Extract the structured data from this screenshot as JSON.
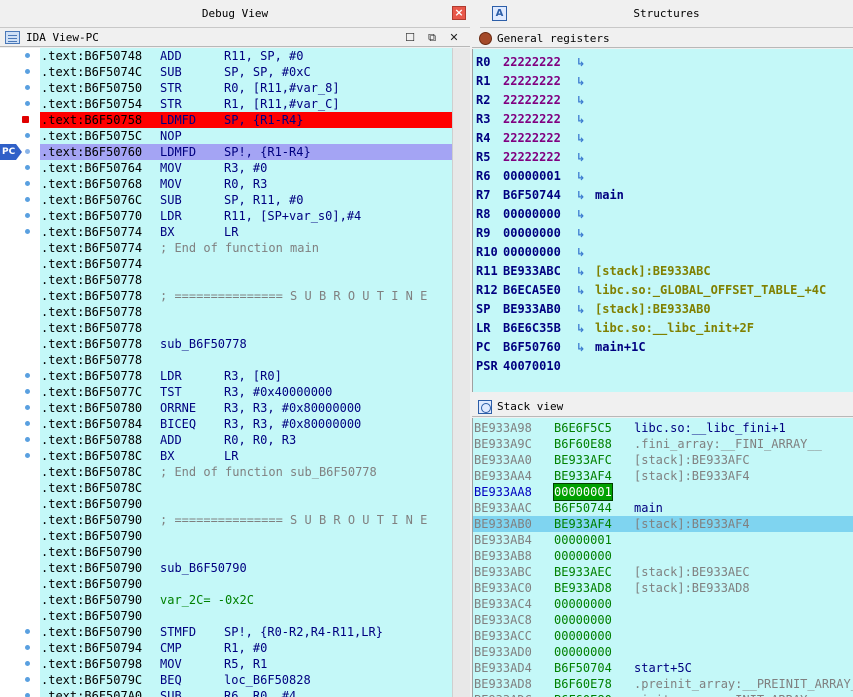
{
  "tabs": {
    "debug_view": "Debug View",
    "structures": "Structures",
    "close_glyph": "×"
  },
  "ida_view": {
    "title": "IDA View-PC",
    "pc_label": "PC",
    "lines": [
      {
        "addr": ".text:B6F50748",
        "mn": "ADD",
        "ops": "R11, SP, #0",
        "dot": true
      },
      {
        "addr": ".text:B6F5074C",
        "mn": "SUB",
        "ops": "SP, SP, #0xC",
        "dot": true
      },
      {
        "addr": ".text:B6F50750",
        "mn": "STR",
        "ops": "R0, [R11,#var_8]",
        "dot": true
      },
      {
        "addr": ".text:B6F50754",
        "mn": "STR",
        "ops": "R1, [R11,#var_C]",
        "dot": true
      },
      {
        "addr": ".text:B6F50758",
        "mn": "LDMFD",
        "ops": "SP, {R1-R4}",
        "dot": false,
        "bp": true,
        "hl": "red"
      },
      {
        "addr": ".text:B6F5075C",
        "mn": "NOP",
        "ops": "",
        "dot": true
      },
      {
        "addr": ".text:B6F50760",
        "mn": "LDMFD",
        "ops": "SP!, {R1-R4}",
        "dot": false,
        "pc": true,
        "hl": "pc"
      },
      {
        "addr": ".text:B6F50764",
        "mn": "MOV",
        "ops": "R3, #0",
        "dot": true
      },
      {
        "addr": ".text:B6F50768",
        "mn": "MOV",
        "ops": "R0, R3",
        "dot": true
      },
      {
        "addr": ".text:B6F5076C",
        "mn": "SUB",
        "ops": "SP, R11, #0",
        "dot": true
      },
      {
        "addr": ".text:B6F50770",
        "mn": "LDR",
        "ops": "R11, [SP+var_s0],#4",
        "dot": true
      },
      {
        "addr": ".text:B6F50774",
        "mn": "BX",
        "ops": "LR",
        "dot": true
      },
      {
        "addr": ".text:B6F50774",
        "comment": "; End of function main"
      },
      {
        "addr": ".text:B6F50774"
      },
      {
        "addr": ".text:B6F50778"
      },
      {
        "addr": ".text:B6F50778",
        "comment": "; =============== S U B R O U T I N E"
      },
      {
        "addr": ".text:B6F50778"
      },
      {
        "addr": ".text:B6F50778"
      },
      {
        "addr": ".text:B6F50778",
        "label": "sub_B6F50778"
      },
      {
        "addr": ".text:B6F50778"
      },
      {
        "addr": ".text:B6F50778",
        "mn": "LDR",
        "ops": "R3, [R0]",
        "dot": true
      },
      {
        "addr": ".text:B6F5077C",
        "mn": "TST",
        "ops": "R3, #0x40000000",
        "dot": true
      },
      {
        "addr": ".text:B6F50780",
        "mn": "ORRNE",
        "ops": "R3, R3, #0x80000000",
        "dot": true
      },
      {
        "addr": ".text:B6F50784",
        "mn": "BICEQ",
        "ops": "R3, R3, #0x80000000",
        "dot": true
      },
      {
        "addr": ".text:B6F50788",
        "mn": "ADD",
        "ops": "R0, R0, R3",
        "dot": true
      },
      {
        "addr": ".text:B6F5078C",
        "mn": "BX",
        "ops": "LR",
        "dot": true
      },
      {
        "addr": ".text:B6F5078C",
        "comment": "; End of function sub_B6F50778"
      },
      {
        "addr": ".text:B6F5078C"
      },
      {
        "addr": ".text:B6F50790"
      },
      {
        "addr": ".text:B6F50790",
        "comment": "; =============== S U B R O U T I N E"
      },
      {
        "addr": ".text:B6F50790"
      },
      {
        "addr": ".text:B6F50790"
      },
      {
        "addr": ".text:B6F50790",
        "label": "sub_B6F50790"
      },
      {
        "addr": ".text:B6F50790"
      },
      {
        "addr": ".text:B6F50790",
        "varline": "var_2C= -0x2C"
      },
      {
        "addr": ".text:B6F50790"
      },
      {
        "addr": ".text:B6F50790",
        "mn": "STMFD",
        "ops": "SP!, {R0-R2,R4-R11,LR}",
        "dot": true
      },
      {
        "addr": ".text:B6F50794",
        "mn": "CMP",
        "ops": "R1, #0",
        "dot": true
      },
      {
        "addr": ".text:B6F50798",
        "mn": "MOV",
        "ops": "R5, R1",
        "dot": true
      },
      {
        "addr": ".text:B6F5079C",
        "mn": "BEQ",
        "ops": "loc_B6F50828",
        "dot": true
      },
      {
        "addr": ".text:B6F507A0",
        "mn": "SUB",
        "ops": "R6, R0, #4",
        "dot": true
      }
    ]
  },
  "registers": {
    "title": "General registers",
    "arrow_glyph": "↳",
    "rows": [
      {
        "name": "R0",
        "value": "22222222",
        "changed": true,
        "ref": ""
      },
      {
        "name": "R1",
        "value": "22222222",
        "changed": true,
        "ref": ""
      },
      {
        "name": "R2",
        "value": "22222222",
        "changed": true,
        "ref": ""
      },
      {
        "name": "R3",
        "value": "22222222",
        "changed": true,
        "ref": ""
      },
      {
        "name": "R4",
        "value": "22222222",
        "changed": true,
        "ref": ""
      },
      {
        "name": "R5",
        "value": "22222222",
        "changed": true,
        "ref": ""
      },
      {
        "name": "R6",
        "value": "00000001",
        "changed": false,
        "ref": ""
      },
      {
        "name": "R7",
        "value": "B6F50744",
        "changed": false,
        "ref": "main",
        "ref_kind": "code"
      },
      {
        "name": "R8",
        "value": "00000000",
        "changed": false,
        "ref": ""
      },
      {
        "name": "R9",
        "value": "00000000",
        "changed": false,
        "ref": ""
      },
      {
        "name": "R10",
        "value": "00000000",
        "changed": false,
        "ref": ""
      },
      {
        "name": "R11",
        "value": "BE933ABC",
        "changed": false,
        "ref": "[stack]:BE933ABC",
        "ref_kind": "data"
      },
      {
        "name": "R12",
        "value": "B6ECA5E0",
        "changed": false,
        "ref": "libc.so:_GLOBAL_OFFSET_TABLE_+4C",
        "ref_kind": "data"
      },
      {
        "name": "SP",
        "value": "BE933AB0",
        "changed": false,
        "ref": "[stack]:BE933AB0",
        "ref_kind": "data"
      },
      {
        "name": "LR",
        "value": "B6E6C35B",
        "changed": false,
        "ref": "libc.so:__libc_init+2F",
        "ref_kind": "data"
      },
      {
        "name": "PC",
        "value": "B6F50760",
        "changed": false,
        "ref": "main+1C",
        "ref_kind": "code"
      },
      {
        "name": "PSR",
        "value": "40070010",
        "changed": false,
        "ref": "",
        "no_arrow": true
      }
    ]
  },
  "stack": {
    "title": "Stack view",
    "rows": [
      {
        "addr": "BE933A98",
        "value": "B6E6F5C5",
        "ref": "libc.so:__libc_fini+1",
        "kind": "code"
      },
      {
        "addr": "BE933A9C",
        "value": "B6F60E88",
        "ref": ".fini_array:__FINI_ARRAY__",
        "kind": "data"
      },
      {
        "addr": "BE933AA0",
        "value": "BE933AFC",
        "ref": "[stack]:BE933AFC",
        "kind": "data"
      },
      {
        "addr": "BE933AA4",
        "value": "BE933AF4",
        "ref": "[stack]:BE933AF4",
        "kind": "data"
      },
      {
        "addr": "BE933AA8",
        "value": "00000001",
        "ref": "",
        "kind": "none",
        "current": true,
        "boxed": true
      },
      {
        "addr": "BE933AAC",
        "value": "B6F50744",
        "ref": "main",
        "kind": "code"
      },
      {
        "addr": "BE933AB0",
        "value": "BE933AF4",
        "ref": "[stack]:BE933AF4",
        "kind": "data",
        "selected": true
      },
      {
        "addr": "BE933AB4",
        "value": "00000001",
        "ref": "",
        "kind": "none"
      },
      {
        "addr": "BE933AB8",
        "value": "00000000",
        "ref": "",
        "kind": "none"
      },
      {
        "addr": "BE933ABC",
        "value": "BE933AEC",
        "ref": "[stack]:BE933AEC",
        "kind": "data"
      },
      {
        "addr": "BE933AC0",
        "value": "BE933AD8",
        "ref": "[stack]:BE933AD8",
        "kind": "data"
      },
      {
        "addr": "BE933AC4",
        "value": "00000000",
        "ref": "",
        "kind": "none"
      },
      {
        "addr": "BE933AC8",
        "value": "00000000",
        "ref": "",
        "kind": "none"
      },
      {
        "addr": "BE933ACC",
        "value": "00000000",
        "ref": "",
        "kind": "none"
      },
      {
        "addr": "BE933AD0",
        "value": "00000000",
        "ref": "",
        "kind": "none"
      },
      {
        "addr": "BE933AD4",
        "value": "B6F50704",
        "ref": "start+5C",
        "kind": "code"
      },
      {
        "addr": "BE933AD8",
        "value": "B6F60E78",
        "ref": ".preinit_array:__PREINIT_ARRAY__",
        "kind": "data"
      },
      {
        "addr": "BE933ADC",
        "value": "B6F60E80",
        "ref": ".init_array:__INIT_ARRAY__",
        "kind": "data"
      }
    ]
  }
}
